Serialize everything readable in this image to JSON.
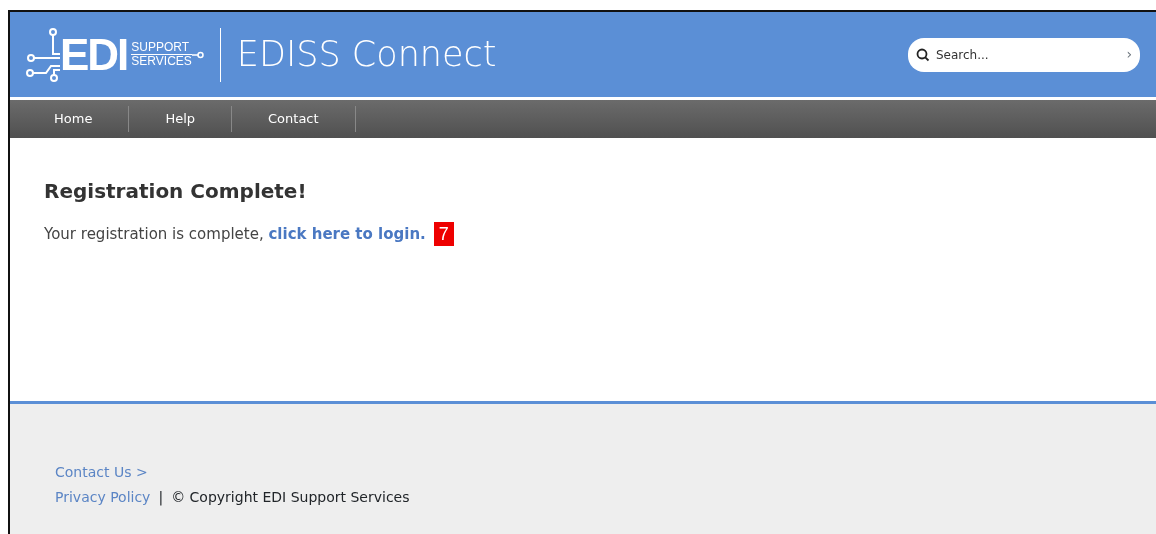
{
  "logo": {
    "mark": "EDI",
    "line_1": "SUPPORT",
    "line_2": "SERVICES"
  },
  "site_title": "EDISS Connect",
  "search": {
    "placeholder": "Search...",
    "button": "›"
  },
  "nav": [
    {
      "label": "Home"
    },
    {
      "label": "Help"
    },
    {
      "label": "Contact"
    }
  ],
  "heading": "Registration Complete!",
  "message": {
    "text": "Your registration is complete, ",
    "link": "click here to login."
  },
  "callout": "7",
  "footer": {
    "contact_link": "Contact Us >",
    "privacy_link": "Privacy Policy",
    "separator": "|",
    "copyright": "© Copyright EDI Support Services"
  }
}
